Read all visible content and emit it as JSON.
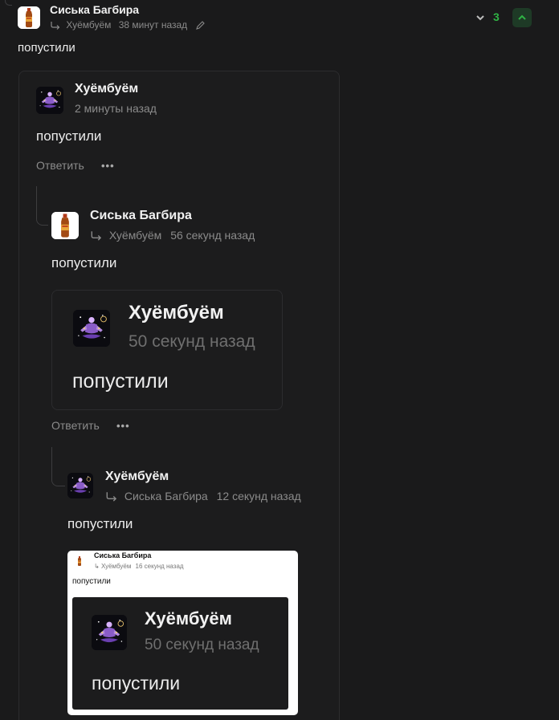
{
  "top_comment": {
    "author": "Сиська Багбира",
    "reply_to": "Хуёмбуём",
    "time": "38 минут назад",
    "text": "попустили",
    "score": "3"
  },
  "nested_1": {
    "author": "Хуёмбуём",
    "time": "2 минуты назад",
    "text": "попустили",
    "reply_label": "Ответить",
    "more_label": "•••"
  },
  "nested_2": {
    "author": "Сиська Багбира",
    "reply_to": "Хуёмбуём",
    "time": "56 секунд назад",
    "text": "попустили",
    "embed": {
      "author": "Хуёмбуём",
      "time": "50 секунд назад",
      "text": "попустили"
    },
    "reply_label": "Ответить",
    "more_label": "•••"
  },
  "nested_3": {
    "author": "Хуёмбуём",
    "reply_to": "Сиська Багбира",
    "time": "12 секунд назад",
    "text": "попустили",
    "screenshot": {
      "author": "Сиська Багбира",
      "reply_to": "Хуёмбуём",
      "time": "16 секунд назад",
      "text": "попустили",
      "embed": {
        "author": "Хуёмбуём",
        "time": "50 секунд назад",
        "text": "попустили"
      }
    }
  },
  "colors": {
    "background": "#1a1a1b",
    "upvote_active": "#2fb344",
    "upvote_bg": "#1e3a26"
  }
}
